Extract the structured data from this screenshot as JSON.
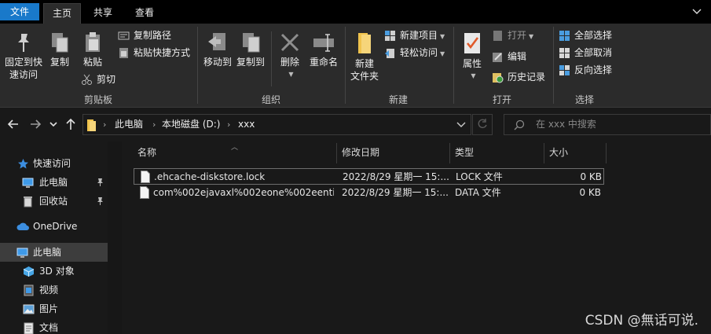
{
  "tabs": {
    "file": "文件",
    "home": "主页",
    "share": "共享",
    "view": "查看"
  },
  "ribbon": {
    "clipboard": {
      "label": "剪贴板",
      "pin_line1": "固定到快",
      "pin_line2": "速访问",
      "copy": "复制",
      "paste": "粘贴",
      "copy_path": "复制路径",
      "paste_shortcut": "粘贴快捷方式",
      "cut": "剪切"
    },
    "organize": {
      "label": "组织",
      "move_to": "移动到",
      "copy_to": "复制到",
      "delete": "删除",
      "rename": "重命名"
    },
    "new": {
      "label": "新建",
      "new_folder_line1": "新建",
      "new_folder_line2": "文件夹",
      "new_item": "新建项目",
      "easy_access": "轻松访问"
    },
    "open": {
      "label": "打开",
      "properties": "属性",
      "open": "打开",
      "edit": "编辑",
      "history": "历史记录"
    },
    "select": {
      "label": "选择",
      "select_all": "全部选择",
      "select_none": "全部取消",
      "invert": "反向选择"
    }
  },
  "address": {
    "crumbs": [
      "此电脑",
      "本地磁盘 (D:)",
      "xxx"
    ],
    "search_placeholder": "在 xxx 中搜索"
  },
  "nav": {
    "items": [
      {
        "label": "快速访问",
        "icon": "star-icon"
      },
      {
        "label": "此电脑",
        "icon": "computer-icon",
        "pinned": true
      },
      {
        "label": "回收站",
        "icon": "recycle-bin-icon",
        "pinned": true
      },
      {
        "label": "OneDrive",
        "icon": "cloud-icon"
      },
      {
        "label": "此电脑",
        "icon": "computer-icon",
        "selected": true
      },
      {
        "label": "3D 对象",
        "icon": "cube-icon"
      },
      {
        "label": "视频",
        "icon": "video-icon"
      },
      {
        "label": "图片",
        "icon": "picture-icon"
      },
      {
        "label": "文档",
        "icon": "document-icon"
      }
    ]
  },
  "table": {
    "columns": [
      "名称",
      "修改日期",
      "类型",
      "大小"
    ],
    "rows": [
      {
        "name": ".ehcache-diskstore.lock",
        "date": "2022/8/29 星期一 15:...",
        "type": "LOCK 文件",
        "size": "0 KB"
      },
      {
        "name": "com%002ejavaxl%002eone%002eenti...",
        "date": "2022/8/29 星期一 15:...",
        "type": "DATA 文件",
        "size": "0 KB"
      }
    ]
  },
  "watermark": "CSDN @無话可说.",
  "colors": {
    "file_tab": "#1979ca",
    "folder": "#f0c34d",
    "background": "#191919",
    "ribbon": "#2b2b2b"
  }
}
